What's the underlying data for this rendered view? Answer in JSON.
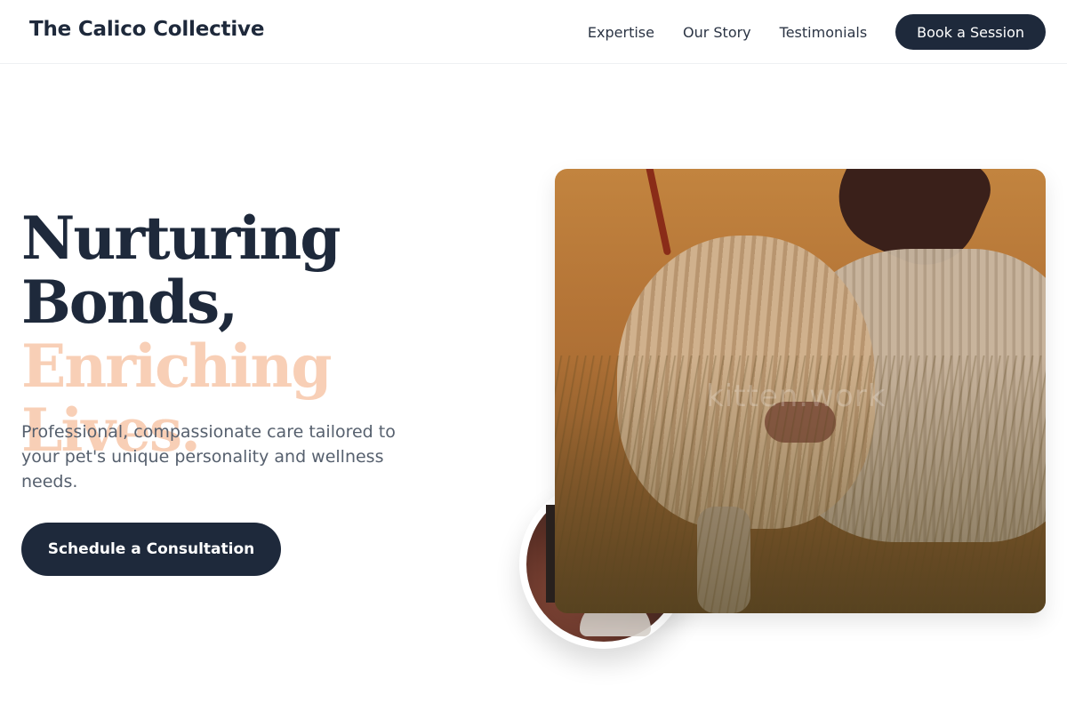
{
  "header": {
    "brand": "The Calico Collective",
    "nav": [
      "Expertise",
      "Our Story",
      "Testimonials"
    ],
    "cta_label": "Book a Session"
  },
  "hero": {
    "headline_line1": "Nurturing",
    "headline_line2": "Bonds,",
    "headline_accent": "Enriching Lives.",
    "subcopy": "Professional, compassionate care tailored to your pet's unique personality and wellness needs.",
    "cta_label": "Schedule a Consultation"
  },
  "media": {
    "main_photo_watermark": "kitten.work"
  },
  "colors": {
    "primary_dark": "#1e293b",
    "accent_peach": "#f8cfb6",
    "body_text": "#56606e"
  }
}
